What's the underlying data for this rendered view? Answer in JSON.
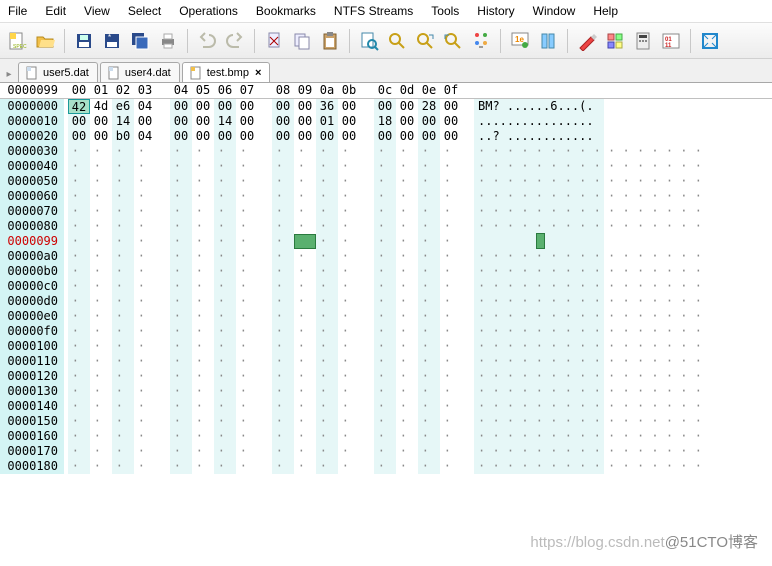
{
  "menu": [
    "File",
    "Edit",
    "View",
    "Select",
    "Operations",
    "Bookmarks",
    "NTFS Streams",
    "Tools",
    "History",
    "Window",
    "Help"
  ],
  "tabs": [
    {
      "label": "user5.dat",
      "active": false,
      "close": false
    },
    {
      "label": "user4.dat",
      "active": false,
      "close": false
    },
    {
      "label": "test.bmp",
      "active": true,
      "close": true
    }
  ],
  "header_offset": "0000099",
  "hex_headers": [
    "00",
    "01",
    "02",
    "03",
    "04",
    "05",
    "06",
    "07",
    "08",
    "09",
    "0a",
    "0b",
    "0c",
    "0d",
    "0e",
    "0f"
  ],
  "rows": [
    {
      "off": "0000000",
      "hx": [
        "42",
        "4d",
        "e6",
        "04",
        "00",
        "00",
        "00",
        "00",
        "00",
        "00",
        "36",
        "00",
        "00",
        "00",
        "28",
        "00"
      ],
      "asc": "BM? ......6...(.",
      "sel0": true
    },
    {
      "off": "0000010",
      "hx": [
        "00",
        "00",
        "14",
        "00",
        "00",
        "00",
        "14",
        "00",
        "00",
        "00",
        "01",
        "00",
        "18",
        "00",
        "00",
        "00"
      ],
      "asc": "................"
    },
    {
      "off": "0000020",
      "hx": [
        "00",
        "00",
        "b0",
        "04",
        "00",
        "00",
        "00",
        "00",
        "00",
        "00",
        "00",
        "00",
        "00",
        "00",
        "00",
        "00"
      ],
      "asc": "..? ............"
    },
    {
      "off": "0000030"
    },
    {
      "off": "0000040"
    },
    {
      "off": "0000050"
    },
    {
      "off": "0000060"
    },
    {
      "off": "0000070"
    },
    {
      "off": "0000080"
    },
    {
      "off": "0000099",
      "cursorRow": true,
      "cursorHexCol": 9,
      "cursorAsciiCol": 8
    },
    {
      "off": "00000a0"
    },
    {
      "off": "00000b0"
    },
    {
      "off": "00000c0"
    },
    {
      "off": "00000d0"
    },
    {
      "off": "00000e0"
    },
    {
      "off": "00000f0"
    },
    {
      "off": "0000100"
    },
    {
      "off": "0000110"
    },
    {
      "off": "0000120"
    },
    {
      "off": "0000130"
    },
    {
      "off": "0000140"
    },
    {
      "off": "0000150"
    },
    {
      "off": "0000160"
    },
    {
      "off": "0000170"
    },
    {
      "off": "0000180"
    }
  ],
  "watermark": {
    "url": "https://blog.csdn.net",
    "label": "@51CTO博客"
  }
}
